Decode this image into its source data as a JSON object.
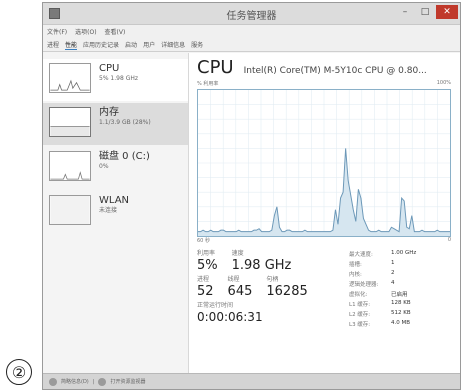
{
  "figure_label": "②",
  "window": {
    "title": "任务管理器",
    "min": "–",
    "max": "□",
    "close": "✕"
  },
  "menu": [
    "文件(F)",
    "选项(O)",
    "查看(V)"
  ],
  "tabs": [
    "进程",
    "性能",
    "应用历史记录",
    "启动",
    "用户",
    "详细信息",
    "服务"
  ],
  "resources": [
    {
      "name": "CPU",
      "sub": "5% 1.98 GHz"
    },
    {
      "name": "内存",
      "sub": "1.1/3.9 GB (28%)"
    },
    {
      "name": "磁盘 0 (C:)",
      "sub": "0%"
    },
    {
      "name": "WLAN",
      "sub": "未连接"
    }
  ],
  "main": {
    "title": "CPU",
    "model": "Intel(R) Core(TM) M-5Y10c CPU @ 0.80...",
    "graph_label": "% 利用率",
    "graph_max": "100%",
    "graph_time": "60 秒",
    "graph_min": "0"
  },
  "stats": {
    "util_label": "利用率",
    "util_value": "5%",
    "speed_label": "速度",
    "speed_value": "1.98 GHz",
    "proc_label": "进程",
    "proc_value": "52",
    "thread_label": "线程",
    "thread_value": "645",
    "handle_label": "句柄",
    "handle_value": "16285",
    "uptime_label": "正常运行时间",
    "uptime_value": "0:00:06:31"
  },
  "details": [
    {
      "key": "最大速度:",
      "value": "1.00 GHz"
    },
    {
      "key": "插槽:",
      "value": "1"
    },
    {
      "key": "内核:",
      "value": "2"
    },
    {
      "key": "逻辑处理器:",
      "value": "4"
    },
    {
      "key": "虚拟化:",
      "value": "已启用"
    },
    {
      "key": "L1 缓存:",
      "value": "128 KB"
    },
    {
      "key": "L2 缓存:",
      "value": "512 KB"
    },
    {
      "key": "L3 缓存:",
      "value": "4.0 MB"
    }
  ],
  "statusbar": {
    "brief": "简略信息(D)",
    "monitor": "打开资源监视器"
  },
  "cpu_history": [
    3,
    3,
    4,
    3,
    3,
    4,
    3,
    3,
    3,
    4,
    4,
    3,
    3,
    3,
    3,
    3,
    4,
    3,
    3,
    3,
    3,
    3,
    4,
    4,
    5,
    3,
    3,
    3,
    3,
    4,
    14,
    20,
    6,
    3,
    3,
    4,
    4,
    3,
    3,
    3,
    3,
    3,
    4,
    3,
    3,
    3,
    3,
    3,
    3,
    3,
    3,
    3,
    3,
    4,
    18,
    8,
    26,
    30,
    60,
    38,
    28,
    18,
    10,
    32,
    26,
    12,
    8,
    4,
    3,
    3,
    3,
    4,
    3,
    3,
    3,
    3,
    6,
    5,
    4,
    3,
    26,
    24,
    6,
    5,
    14,
    3,
    3,
    3,
    4,
    3,
    3,
    3,
    3,
    3,
    4,
    3,
    3,
    3,
    3,
    3
  ]
}
